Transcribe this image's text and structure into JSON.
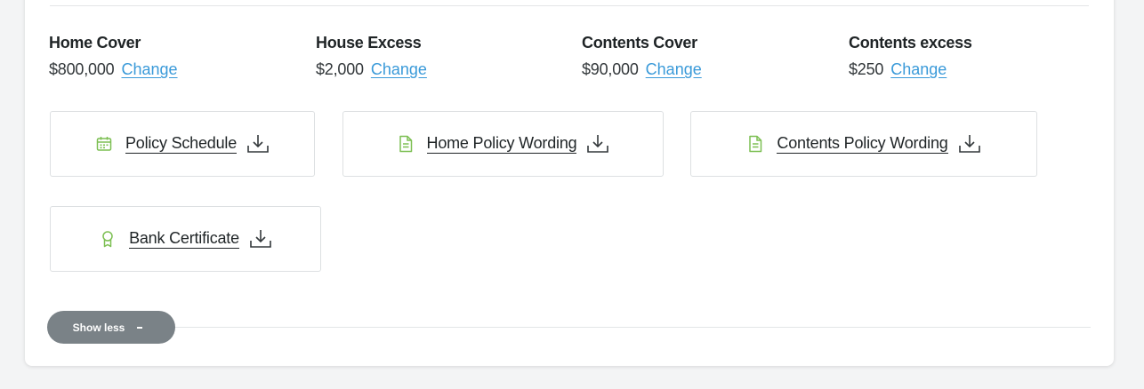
{
  "covers": [
    {
      "label": "Home Cover",
      "value": "$800,000",
      "action": "Change"
    },
    {
      "label": "House Excess",
      "value": "$2,000",
      "action": "Change"
    },
    {
      "label": "Contents Cover",
      "value": "$90,000",
      "action": "Change"
    },
    {
      "label": "Contents excess",
      "value": "$250",
      "action": "Change"
    }
  ],
  "documents": [
    {
      "label": "Policy Schedule",
      "icon": "calendar-icon"
    },
    {
      "label": "Home Policy Wording",
      "icon": "document-icon"
    },
    {
      "label": "Contents Policy Wording",
      "icon": "document-icon"
    },
    {
      "label": "Bank Certificate",
      "icon": "award-icon"
    }
  ],
  "download_icon": "download-icon",
  "toggle": {
    "label": "Show less"
  },
  "colors": {
    "link": "#3a9ad9",
    "icon_green": "#7cbf52",
    "toggle_bg": "#7a8287"
  }
}
